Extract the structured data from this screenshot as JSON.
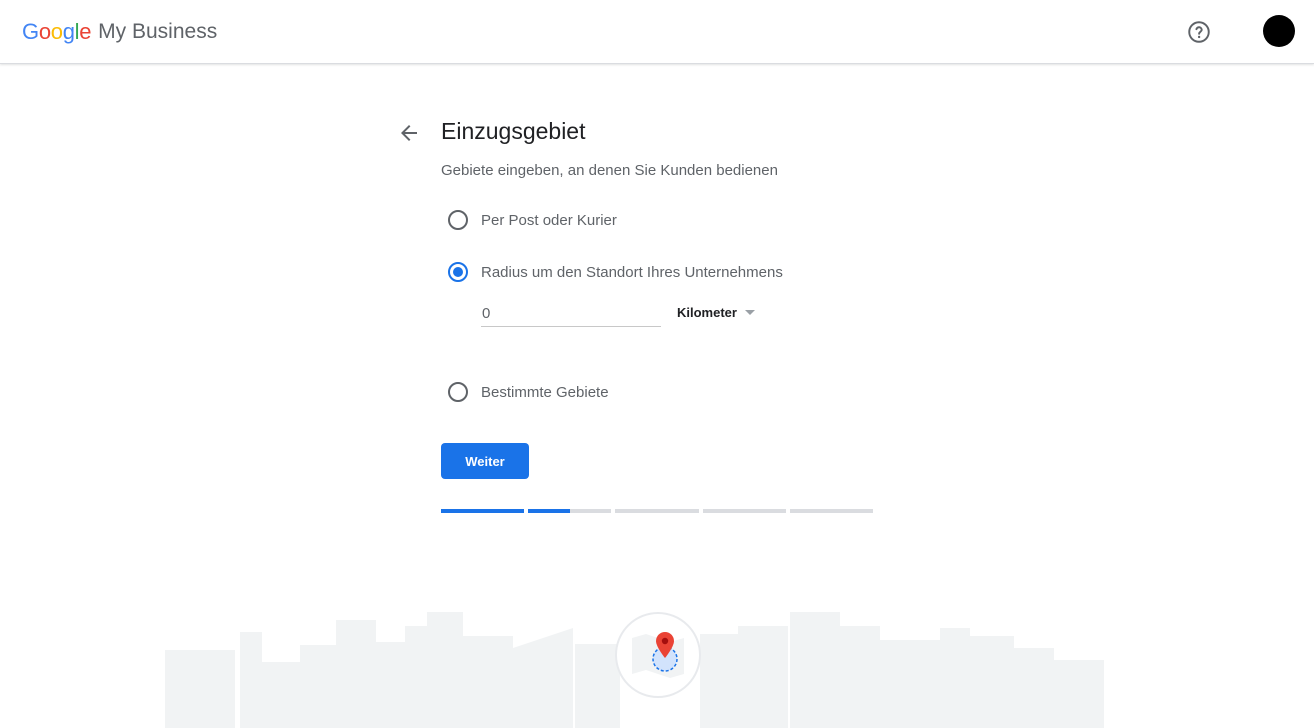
{
  "header": {
    "logo_letters": [
      {
        "char": "G",
        "color": "#4285F4"
      },
      {
        "char": "o",
        "color": "#EA4335"
      },
      {
        "char": "o",
        "color": "#FBBC05"
      },
      {
        "char": "g",
        "color": "#4285F4"
      },
      {
        "char": "l",
        "color": "#34A853"
      },
      {
        "char": "e",
        "color": "#EA4335"
      }
    ],
    "product_name": "My Business",
    "help_icon": "help-circle-icon",
    "avatar_color": "#000000"
  },
  "page": {
    "back_icon": "arrow-back-icon",
    "title": "Einzugsgebiet",
    "subtitle": "Gebiete eingeben, an denen Sie Kunden bedienen"
  },
  "options": [
    {
      "label": "Per Post oder Kurier",
      "checked": false
    },
    {
      "label": "Radius um den Standort Ihres Unternehmens",
      "checked": true
    },
    {
      "label": "Bestimmte Gebiete",
      "checked": false
    }
  ],
  "radius": {
    "value": "0",
    "unit": "Kilometer"
  },
  "actions": {
    "next_label": "Weiter"
  },
  "progress": {
    "segments": [
      1,
      0.5,
      0,
      0,
      0
    ]
  },
  "colors": {
    "accent": "#1a73e8"
  }
}
